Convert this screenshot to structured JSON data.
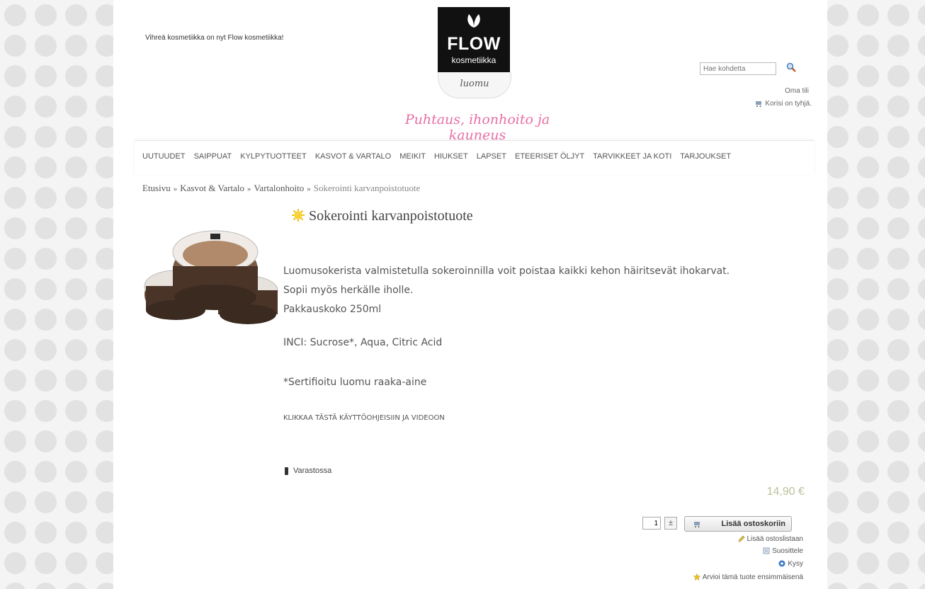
{
  "header": {
    "promo": "Vihreä kosmetiikka on nyt Flow kosmetiikka!",
    "logo": {
      "word": "FLOW",
      "sub": "kosmetiikka",
      "tag": "luomu"
    },
    "tagline": "Puhtaus, ihonhoito ja kauneus",
    "search": {
      "placeholder": "Hae kohdetta"
    },
    "account": "Oma tili",
    "cart": "Korisi on tyhjä."
  },
  "nav": {
    "items": [
      "UUTUUDET",
      "SAIPPUAT",
      "KYLPYTUOTTEET",
      "KASVOT & VARTALO",
      "MEIKIT",
      "HIUKSET",
      "LAPSET",
      "ETEERISET ÖLJYT",
      "TARVIKKEET JA KOTI",
      "TARJOUKSET"
    ]
  },
  "breadcrumb": {
    "items": [
      "Etusivu",
      "Kasvot & Vartalo",
      "Vartalonhoito"
    ],
    "separator": "»",
    "current": "Sokerointi karvanpoistotuote"
  },
  "product": {
    "title": "Sokerointi karvanpoistotuote",
    "description": [
      "Luomusokerista valmistetulla sokeroinnilla voit poistaa kaikki kehon häiritsevät ihokarvat.",
      "Sopii myös herkälle iholle.",
      "Pakkauskoko 250ml"
    ],
    "inci": "INCI: Sucrose*, Aqua, Citric Acid",
    "certified": "*Sertifioitu luomu raaka-aine",
    "instructions_link": "KLIKKAA TÄSTÄ KÄYTTÖOHJEISIIN JA VIDEOON",
    "stock": "Varastossa",
    "price": "14,90 €",
    "quantity": "1",
    "qty_toggle": "±",
    "add_to_cart": "Lisää ostoskoriin",
    "add_to_wishlist": "Lisää ostoslistaan",
    "recommend": "Suosittele",
    "ask": "Kysy",
    "review": "Arvioi tämä tuote ensimmäisenä"
  },
  "colors": {
    "tagline": "#e86ea6",
    "price": "#bbc29a",
    "logo_bg": "#111111"
  }
}
